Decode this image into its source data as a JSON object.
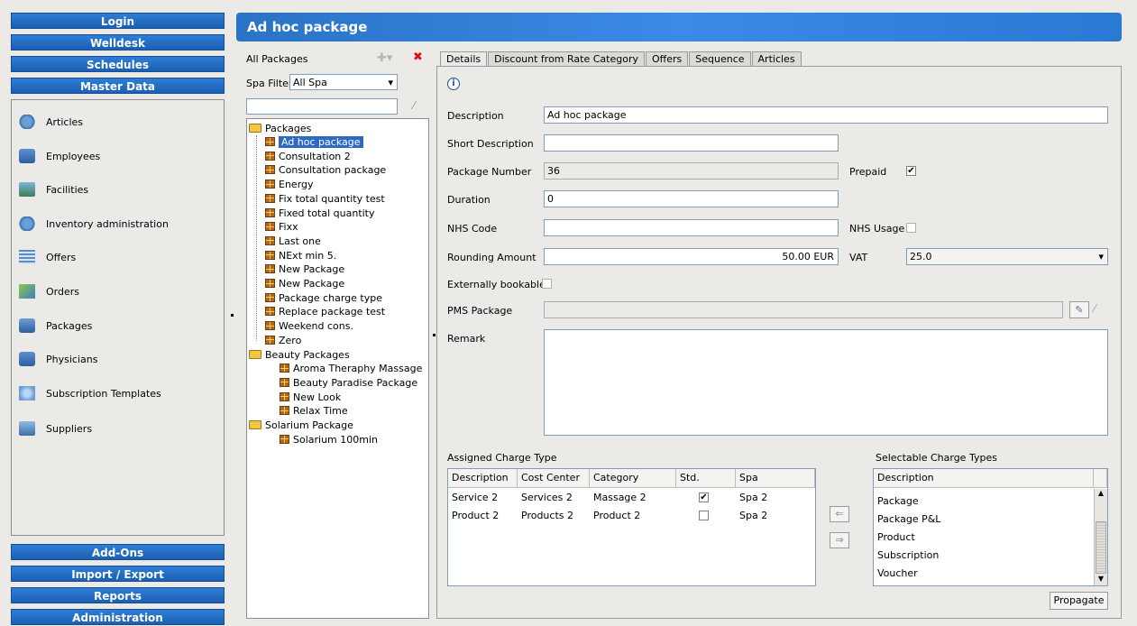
{
  "nav": {
    "top_buttons": [
      "Login",
      "Welldesk",
      "Schedules",
      "Master Data"
    ],
    "items": [
      {
        "label": "Articles",
        "icon": "articles-icon"
      },
      {
        "label": "Employees",
        "icon": "employees-icon"
      },
      {
        "label": "Facilities",
        "icon": "facilities-icon"
      },
      {
        "label": "Inventory administration",
        "icon": "inventory-icon"
      },
      {
        "label": "Offers",
        "icon": "offers-icon"
      },
      {
        "label": "Orders",
        "icon": "orders-icon"
      },
      {
        "label": "Packages",
        "icon": "packages-icon"
      },
      {
        "label": "Physicians",
        "icon": "physicians-icon"
      },
      {
        "label": "Subscription Templates",
        "icon": "subscription-icon"
      },
      {
        "label": "Suppliers",
        "icon": "suppliers-icon"
      }
    ],
    "bottom_buttons": [
      "Add-Ons",
      "Import / Export",
      "Reports",
      "Administration"
    ]
  },
  "header": {
    "title": "Ad hoc package"
  },
  "list": {
    "title": "All Packages",
    "spa_filter_label": "Spa Filter",
    "spa_filter_value": "All Spa",
    "search_value": ""
  },
  "tree": {
    "root": "Packages",
    "items": [
      "Ad hoc package",
      "Consultation 2",
      "Consultation package",
      "Energy",
      "Fix total quantity test",
      "Fixed total quantity",
      "Fixx",
      "Last one",
      "NExt min 5.",
      "New Package",
      "New Package",
      "Package charge type",
      "Replace package test",
      "Weekend cons.",
      "Zero"
    ],
    "group2": "Beauty Packages",
    "group2_items": [
      "Aroma Theraphy Massage",
      "Beauty Paradise Package",
      "New Look",
      "Relax Time"
    ],
    "group3": "Solarium Package",
    "group3_items": [
      "Solarium 100min"
    ]
  },
  "tabs": [
    "Details",
    "Discount from Rate Category",
    "Offers",
    "Sequence",
    "Articles"
  ],
  "form": {
    "description_label": "Description",
    "description_value": "Ad hoc package",
    "short_description_label": "Short Description",
    "short_description_value": "",
    "package_number_label": "Package Number",
    "package_number_value": "36",
    "prepaid_label": "Prepaid",
    "prepaid_checked": "✔",
    "duration_label": "Duration",
    "duration_value": "0",
    "nhs_code_label": "NHS Code",
    "nhs_code_value": "",
    "nhs_usage_label": "NHS Usage",
    "rounding_label": "Rounding Amount",
    "rounding_value": "50.00 EUR",
    "vat_label": "VAT",
    "vat_value": "25.0",
    "external_label": "Externally bookable",
    "pms_label": "PMS Package",
    "pms_value": "",
    "remark_label": "Remark",
    "remark_value": ""
  },
  "assigned": {
    "title": "Assigned Charge Type",
    "columns": [
      "Description",
      "Cost Center",
      "Category",
      "Std.",
      "Spa"
    ],
    "rows": [
      {
        "description": "Service 2",
        "cost_center": "Services 2",
        "category": "Massage 2",
        "std": "✔",
        "spa": "Spa 2"
      },
      {
        "description": "Product 2",
        "cost_center": "Products 2",
        "category": "Product 2",
        "std": "",
        "spa": "Spa 2"
      }
    ]
  },
  "selectable": {
    "title": "Selectable Charge Types",
    "column": "Description",
    "items": [
      "Package",
      "Package P&L",
      "Product",
      "Subscription",
      "Voucher"
    ]
  },
  "propagate_label": "Propagate"
}
